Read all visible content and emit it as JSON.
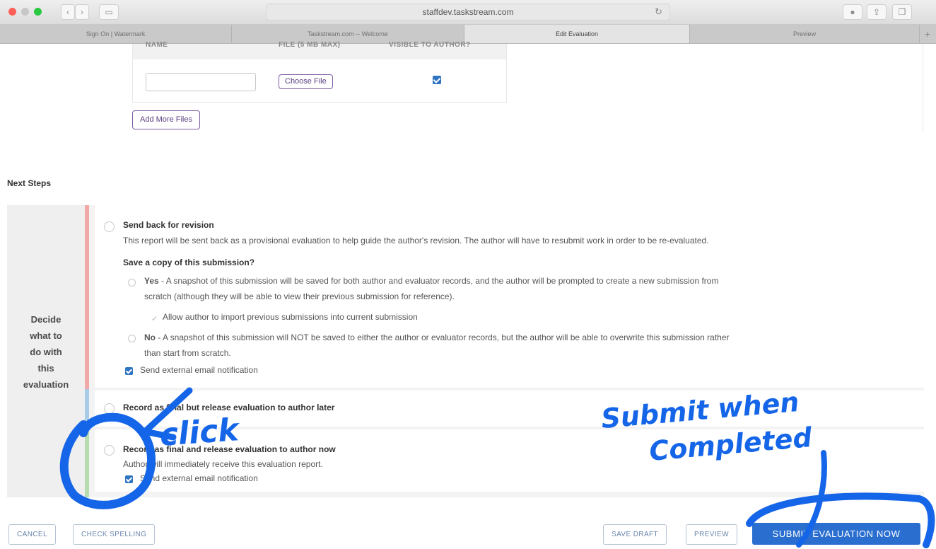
{
  "browser": {
    "address": "staffdev.taskstream.com",
    "tabs": [
      {
        "label": "Sign On | Watermark",
        "active": false
      },
      {
        "label": "Taskstream.com -- Welcome",
        "active": false
      },
      {
        "label": "Edit Evaluation",
        "active": true
      },
      {
        "label": "Preview",
        "active": false
      }
    ]
  },
  "files": {
    "headers": [
      "NAME",
      "FILE (5 MB MAX)",
      "VISIBLE TO AUTHOR?"
    ],
    "name_value": "",
    "choose_label": "Choose File",
    "visible_checked": true,
    "add_more_label": "Add More Files"
  },
  "next_steps": {
    "heading": "Next Steps",
    "side_label": [
      "Decide",
      "what to",
      "do with",
      "this",
      "evaluation"
    ],
    "options": {
      "revision": {
        "title": "Send back for revision",
        "desc": "This report will be sent back as a provisional evaluation to help guide the author's revision. The author will have to resubmit work in order to be re-evaluated.",
        "save_copy_heading": "Save a copy of this submission?",
        "yes_label": "Yes",
        "yes_line1": " - A snapshot of this submission will be saved for both author and evaluator records, and the author will be prompted to create a new submission from",
        "yes_line2": "scratch (although they will be able to view their previous submission for reference).",
        "allow_import": "Allow author to import previous submissions into current submission",
        "no_label": "No",
        "no_line1": " - A snapshot of this submission will NOT be saved to either the author or evaluator records, but the author will be able to overwrite this submission rather",
        "no_line2": "than start from scratch.",
        "email_notification": "Send external email notification"
      },
      "later": {
        "title": "Record as final but release evaluation to author later"
      },
      "now": {
        "title": "Record as final and release evaluation to author now",
        "desc": "Author will immediately receive this evaluation report.",
        "email_notification": "Send external email notification"
      }
    }
  },
  "buttons": {
    "cancel": "CANCEL",
    "check_spelling": "CHECK SPELLING",
    "save_draft": "SAVE DRAFT",
    "preview": "PREVIEW",
    "submit": "SUBMIT EVALUATION NOW"
  },
  "annotations": {
    "click": "click",
    "submit_line1": "Submit when",
    "submit_line2": "Completed",
    "color": "#1565e8"
  }
}
